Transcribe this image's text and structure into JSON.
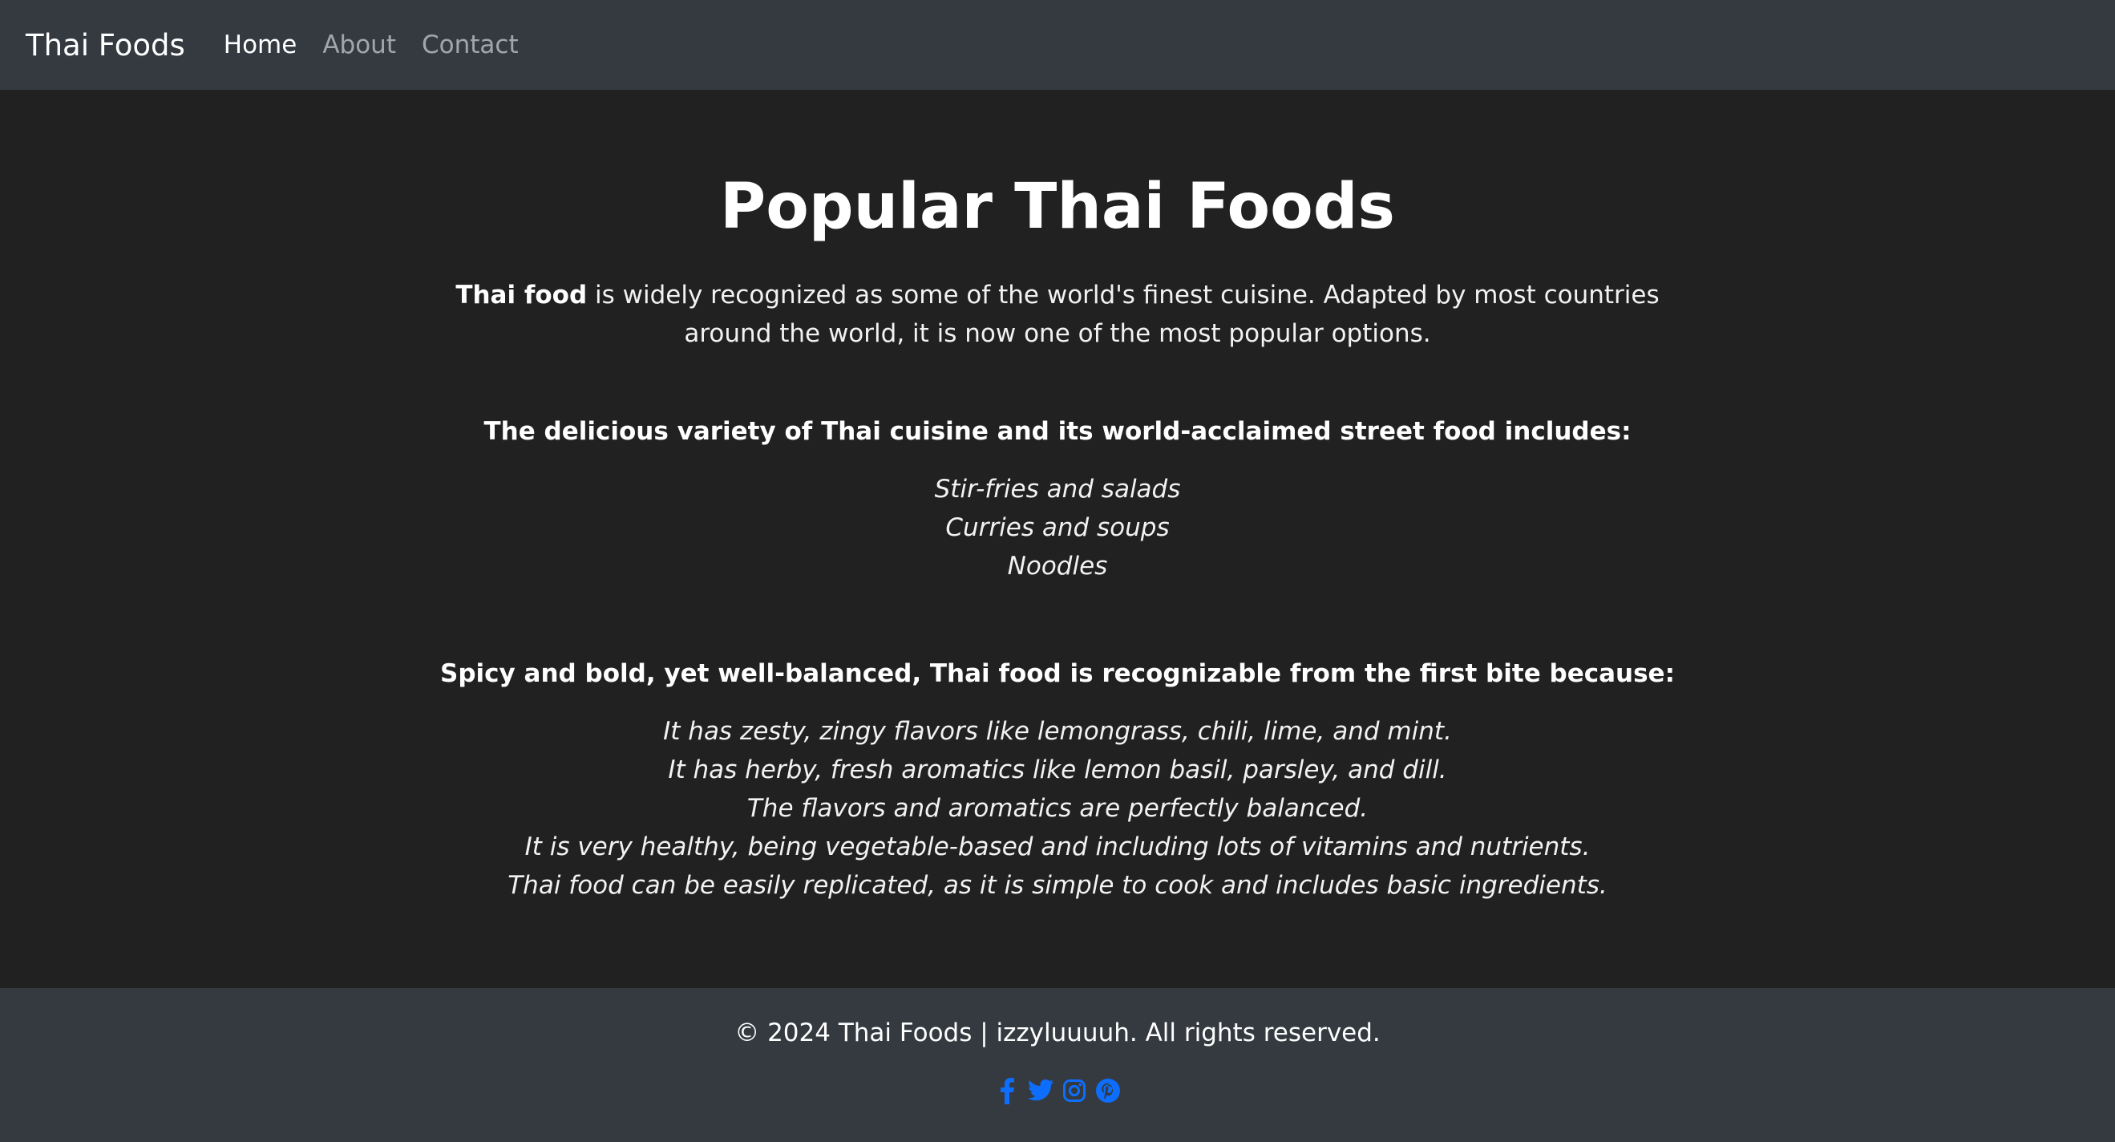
{
  "navbar": {
    "brand": "Thai Foods",
    "links": [
      {
        "label": "Home",
        "active": true
      },
      {
        "label": "About",
        "active": false
      },
      {
        "label": "Contact",
        "active": false
      }
    ]
  },
  "main": {
    "title": "Popular Thai Foods",
    "intro_bold": "Thai food",
    "intro_rest": " is widely recognized as some of the world's finest cuisine. Adapted by most countries around the world, it is now one of the most popular options.",
    "section1": {
      "heading": "The delicious variety of Thai cuisine and its world-acclaimed street food includes:",
      "items": [
        "Stir-fries and salads",
        "Curries and soups",
        "Noodles"
      ]
    },
    "section2": {
      "heading": "Spicy and bold, yet well-balanced, Thai food is recognizable from the first bite because:",
      "items": [
        "It has zesty, zingy flavors like lemongrass, chili, lime, and mint.",
        "It has herby, fresh aromatics like lemon basil, parsley, and dill.",
        "The flavors and aromatics are perfectly balanced.",
        "It is very healthy, being vegetable-based and including lots of vitamins and nutrients.",
        "Thai food can be easily replicated, as it is simple to cook and includes basic ingredients."
      ]
    }
  },
  "footer": {
    "copyright": "© 2024 Thai Foods | izzyluuuuh. All rights reserved.",
    "socials": [
      {
        "icon": "facebook-icon"
      },
      {
        "icon": "twitter-icon"
      },
      {
        "icon": "instagram-icon"
      },
      {
        "icon": "pinterest-icon"
      }
    ],
    "icon_color": "#0d6efd"
  },
  "colors": {
    "navbar_bg": "#343a40",
    "body_bg": "#212121",
    "text": "#ffffff",
    "nav_inactive": "#9a9da0",
    "accent": "#0d6efd"
  }
}
